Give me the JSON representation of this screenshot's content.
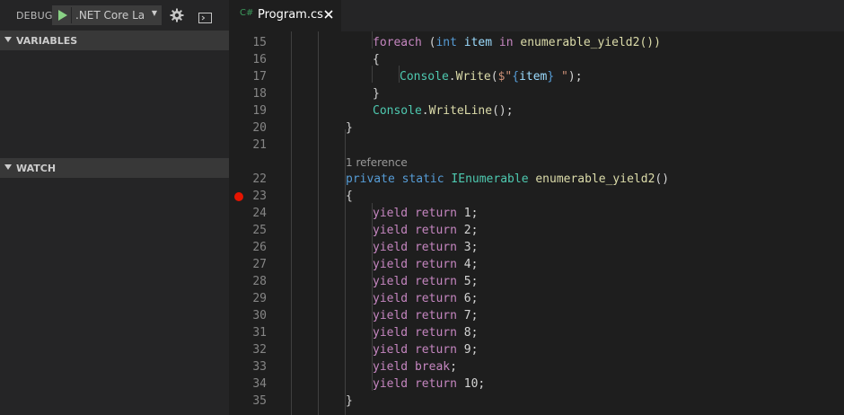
{
  "debug": {
    "label": "DEBUG",
    "config_name": ".NET Core Launch (console)"
  },
  "panels": {
    "variables": "VARIABLES",
    "watch": "WATCH"
  },
  "tab": {
    "icon": "C#",
    "label": "Program.cs"
  },
  "codelens": "1 reference",
  "colors": {
    "accent_breakpoint": "#e51400",
    "keyword": "#569cd6",
    "control": "#c586c0",
    "type": "#4ec9b0",
    "function": "#dcdcaa",
    "string": "#ce9178"
  },
  "code": {
    "l15": {
      "num": "15",
      "t1": "foreach",
      "t2": " (",
      "t3": "int",
      "t4": " item ",
      "t5": "in",
      "t6": " enumerable_yield2())"
    },
    "l16": {
      "num": "16",
      "t1": "{"
    },
    "l17": {
      "num": "17",
      "t1": "Console",
      "t2": ".",
      "t3": "Write",
      "t4": "(",
      "t5": "$\"",
      "t6": "{",
      "t7": "item",
      "t8": "}",
      "t9": " \"",
      "t10": ");"
    },
    "l18": {
      "num": "18",
      "t1": "}"
    },
    "l19": {
      "num": "19",
      "t1": "Console",
      "t2": ".",
      "t3": "WriteLine",
      "t4": "();"
    },
    "l20": {
      "num": "20",
      "t1": "}"
    },
    "l21": {
      "num": "21"
    },
    "l22": {
      "num": "22",
      "t1": "private",
      "t2": " ",
      "t3": "static",
      "t4": " ",
      "t5": "IEnumerable",
      "t6": " ",
      "t7": "enumerable_yield2",
      "t8": "()"
    },
    "l23": {
      "num": "23",
      "t1": "{"
    },
    "l24": {
      "num": "24",
      "t1": "yield",
      "t2": " ",
      "t3": "return",
      "t4": " 1;"
    },
    "l25": {
      "num": "25",
      "t1": "yield",
      "t2": " ",
      "t3": "return",
      "t4": " 2;"
    },
    "l26": {
      "num": "26",
      "t1": "yield",
      "t2": " ",
      "t3": "return",
      "t4": " 3;"
    },
    "l27": {
      "num": "27",
      "t1": "yield",
      "t2": " ",
      "t3": "return",
      "t4": " 4;"
    },
    "l28": {
      "num": "28",
      "t1": "yield",
      "t2": " ",
      "t3": "return",
      "t4": " 5;"
    },
    "l29": {
      "num": "29",
      "t1": "yield",
      "t2": " ",
      "t3": "return",
      "t4": " 6;"
    },
    "l30": {
      "num": "30",
      "t1": "yield",
      "t2": " ",
      "t3": "return",
      "t4": " 7;"
    },
    "l31": {
      "num": "31",
      "t1": "yield",
      "t2": " ",
      "t3": "return",
      "t4": " 8;"
    },
    "l32": {
      "num": "32",
      "t1": "yield",
      "t2": " ",
      "t3": "return",
      "t4": " 9;"
    },
    "l33": {
      "num": "33",
      "t1": "yield",
      "t2": " ",
      "t3": "break",
      "t4": ";"
    },
    "l34": {
      "num": "34",
      "t1": "yield",
      "t2": " ",
      "t3": "return",
      "t4": " 10;"
    },
    "l35": {
      "num": "35",
      "t1": "}"
    }
  }
}
